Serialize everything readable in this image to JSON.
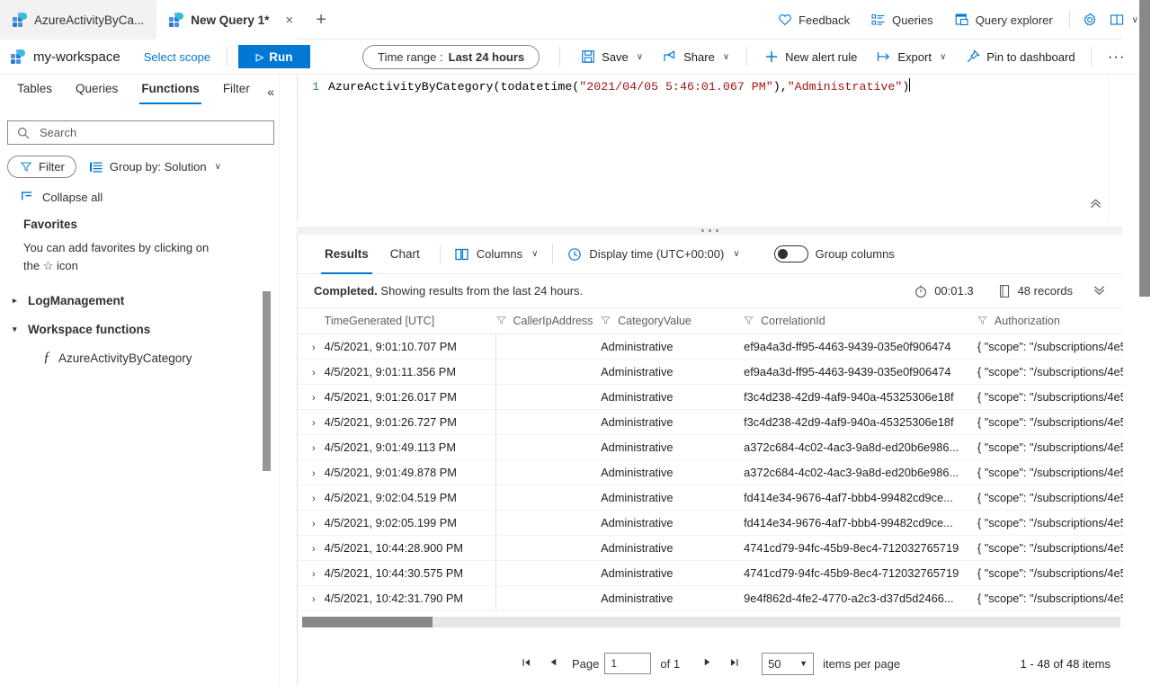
{
  "tabstrip": {
    "tabs": [
      {
        "label": "AzureActivityByCa...",
        "icon": "log-analytics-icon",
        "active": false
      },
      {
        "label": "New Query 1*",
        "icon": "log-analytics-icon",
        "active": true,
        "close": "×"
      }
    ],
    "new_tab": "+",
    "right_items": [
      {
        "label": "Feedback",
        "icon": "heart-icon"
      },
      {
        "label": "Queries",
        "icon": "list-icon"
      },
      {
        "label": "Query explorer",
        "icon": "window-icon"
      }
    ],
    "settings_icon": "gear-icon",
    "help_icon": "book-icon",
    "help_chevron": "∨"
  },
  "commandbar": {
    "workspace": "my-workspace",
    "workspace_icon": "log-analytics-icon",
    "select_scope": "Select scope",
    "run": {
      "label": "Run",
      "icon": "play-icon"
    },
    "time_range": {
      "prefix": "Time range :",
      "value": "Last 24 hours"
    },
    "save": {
      "label": "Save",
      "icon": "save-icon",
      "chevron": "∨"
    },
    "share": {
      "label": "Share",
      "icon": "share-icon",
      "chevron": "∨"
    },
    "new_alert_rule": {
      "label": "New alert rule",
      "icon": "plus-icon"
    },
    "export": {
      "label": "Export",
      "icon": "export-icon",
      "chevron": "∨"
    },
    "pin": {
      "label": "Pin to dashboard",
      "icon": "pin-icon"
    },
    "more": "···"
  },
  "leftpanel": {
    "tabs": [
      {
        "label": "Tables",
        "active": false
      },
      {
        "label": "Queries",
        "active": false
      },
      {
        "label": "Functions",
        "active": true
      },
      {
        "label": "Filter",
        "active": false
      }
    ],
    "collapse_icon": "«",
    "search": {
      "placeholder": "Search",
      "value": "",
      "icon": "search-icon"
    },
    "filter_pill": {
      "label": "Filter",
      "icon": "funnel-icon"
    },
    "group_by": {
      "label": "Group by: Solution",
      "icon": "group-icon",
      "chevron": "∨"
    },
    "collapse_all": {
      "label": "Collapse all",
      "icon": "collapse-all-icon"
    },
    "favorites": {
      "title": "Favorites",
      "description_part1": "You can add favorites by clicking on",
      "description_part2": "the ☆ icon"
    },
    "nodes": [
      {
        "label": "LogManagement",
        "expanded": false,
        "caret": "▸"
      },
      {
        "label": "Workspace functions",
        "expanded": true,
        "caret": "▾"
      }
    ],
    "leaf": {
      "label": "AzureActivityByCategory",
      "icon": "function-icon"
    }
  },
  "editor": {
    "line_number": "1",
    "code_segments": [
      {
        "text": "AzureActivityByCategory(todatetime(",
        "type": "plain"
      },
      {
        "text": "\"2021/04/05 5:46:01.067 PM\"",
        "type": "string"
      },
      {
        "text": "),",
        "type": "plain"
      },
      {
        "text": "\"Administrative\"",
        "type": "string"
      },
      {
        "text": ")",
        "type": "plain"
      }
    ],
    "collapse_icon": "«"
  },
  "results": {
    "tabs": [
      {
        "label": "Results",
        "active": true
      },
      {
        "label": "Chart",
        "active": false
      }
    ],
    "columns_btn": {
      "label": "Columns",
      "icon": "columns-icon",
      "chevron": "∨"
    },
    "display_time": {
      "label": "Display time (UTC+00:00)",
      "icon": "clock-icon",
      "chevron": "∨"
    },
    "group_columns": {
      "label": "Group columns",
      "enabled": false
    },
    "status": {
      "completed": "Completed.",
      "message": " Showing results from the last 24 hours.",
      "duration": "00:01.3",
      "duration_icon": "stopwatch-icon",
      "records": "48 records",
      "records_icon": "records-icon",
      "expand_icon": "»"
    },
    "table": {
      "headers": [
        {
          "label": "TimeGenerated [UTC]",
          "filter": false
        },
        {
          "label": "CallerIpAddress",
          "filter": true
        },
        {
          "label": "CategoryValue",
          "filter": true
        },
        {
          "label": "CorrelationId",
          "filter": true
        },
        {
          "label": "Authorization",
          "filter": true
        }
      ],
      "rows": [
        {
          "time": "4/5/2021, 9:01:10.707 PM",
          "ip": "",
          "category": "Administrative",
          "correlation": "ef9a4a3d-ff95-4463-9439-035e0f906474",
          "authorization": "{ \"scope\": \"/subscriptions/4e5"
        },
        {
          "time": "4/5/2021, 9:01:11.356 PM",
          "ip": "",
          "category": "Administrative",
          "correlation": "ef9a4a3d-ff95-4463-9439-035e0f906474",
          "authorization": "{ \"scope\": \"/subscriptions/4e5"
        },
        {
          "time": "4/5/2021, 9:01:26.017 PM",
          "ip": "",
          "category": "Administrative",
          "correlation": "f3c4d238-42d9-4af9-940a-45325306e18f",
          "authorization": "{ \"scope\": \"/subscriptions/4e5"
        },
        {
          "time": "4/5/2021, 9:01:26.727 PM",
          "ip": "",
          "category": "Administrative",
          "correlation": "f3c4d238-42d9-4af9-940a-45325306e18f",
          "authorization": "{ \"scope\": \"/subscriptions/4e5"
        },
        {
          "time": "4/5/2021, 9:01:49.113 PM",
          "ip": "",
          "category": "Administrative",
          "correlation": "a372c684-4c02-4ac3-9a8d-ed20b6e986...",
          "authorization": "{ \"scope\": \"/subscriptions/4e5"
        },
        {
          "time": "4/5/2021, 9:01:49.878 PM",
          "ip": "",
          "category": "Administrative",
          "correlation": "a372c684-4c02-4ac3-9a8d-ed20b6e986...",
          "authorization": "{ \"scope\": \"/subscriptions/4e5"
        },
        {
          "time": "4/5/2021, 9:02:04.519 PM",
          "ip": "",
          "category": "Administrative",
          "correlation": "fd414e34-9676-4af7-bbb4-99482cd9ce...",
          "authorization": "{ \"scope\": \"/subscriptions/4e5"
        },
        {
          "time": "4/5/2021, 9:02:05.199 PM",
          "ip": "",
          "category": "Administrative",
          "correlation": "fd414e34-9676-4af7-bbb4-99482cd9ce...",
          "authorization": "{ \"scope\": \"/subscriptions/4e5"
        },
        {
          "time": "4/5/2021, 10:44:28.900 PM",
          "ip": "",
          "category": "Administrative",
          "correlation": "4741cd79-94fc-45b9-8ec4-712032765719",
          "authorization": "{ \"scope\": \"/subscriptions/4e5"
        },
        {
          "time": "4/5/2021, 10:44:30.575 PM",
          "ip": "",
          "category": "Administrative",
          "correlation": "4741cd79-94fc-45b9-8ec4-712032765719",
          "authorization": "{ \"scope\": \"/subscriptions/4e5"
        },
        {
          "time": "4/5/2021, 10:42:31.790 PM",
          "ip": "",
          "category": "Administrative",
          "correlation": "9e4f862d-4fe2-4770-a2c3-d37d5d2466...",
          "authorization": "{ \"scope\": \"/subscriptions/4e5"
        }
      ],
      "row_expand_icon": "›"
    },
    "pager": {
      "first": "⏮",
      "prev": "◀",
      "page_label": "Page",
      "page_value": "1",
      "of_label": "of 1",
      "next": "▶",
      "last": "⏭",
      "page_size": "50",
      "page_size_chevron": "▼",
      "items_per_page": "items per page",
      "range": "1 - 48 of 48 items"
    }
  }
}
